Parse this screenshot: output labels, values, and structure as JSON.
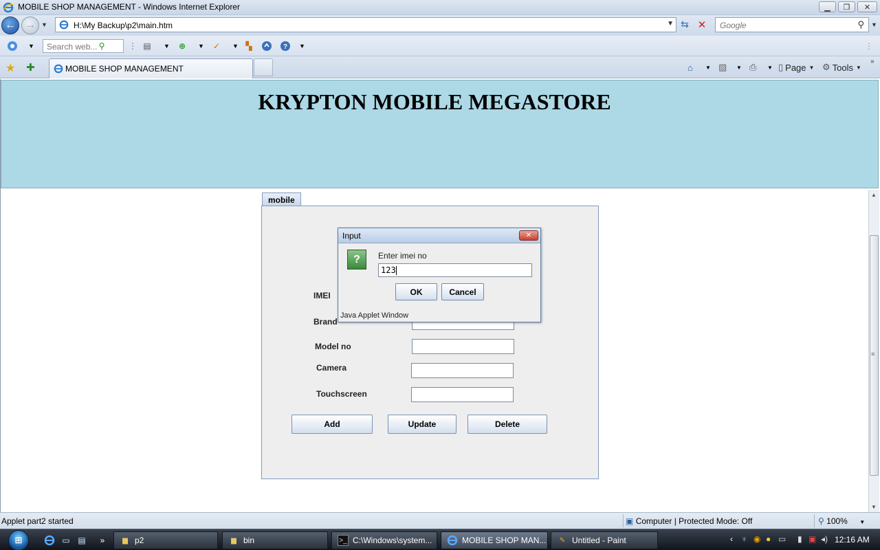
{
  "window": {
    "title": "MOBILE SHOP MANAGEMENT - Windows Internet Explorer"
  },
  "address_bar": {
    "url": "H:\\My Backup\\p2\\main.htm",
    "search_placeholder": "Google"
  },
  "toolbar": {
    "search_placeholder": "Search web..."
  },
  "tabs": {
    "active_label": "MOBILE SHOP MANAGEMENT"
  },
  "commands": {
    "page_label": "Page",
    "tools_label": "Tools"
  },
  "page": {
    "header_title": "KRYPTON MOBILE MEGASTORE",
    "header_bg": "#add8e6"
  },
  "applet": {
    "tab_label": "mobile",
    "fields": {
      "imei_label": "IMEI",
      "brand_label": "Brand",
      "model_label": "Model no",
      "camera_label": "Camera",
      "touchscreen_label": "Touchscreen"
    },
    "buttons": {
      "add": "Add",
      "update": "Update",
      "delete": "Delete"
    }
  },
  "dialog": {
    "title": "Input",
    "prompt": "Enter imei no",
    "input_value": "123",
    "ok_label": "OK",
    "cancel_label": "Cancel",
    "footer": "Java Applet Window"
  },
  "status_bar": {
    "text": "Applet part2 started",
    "zone": "Computer | Protected Mode: Off",
    "zoom": "100%"
  },
  "taskbar": {
    "buttons": [
      "p2",
      "bin",
      "C:\\Windows\\system...",
      "MOBILE SHOP MAN...",
      "Untitled - Paint"
    ],
    "clock": "12:16 AM"
  }
}
